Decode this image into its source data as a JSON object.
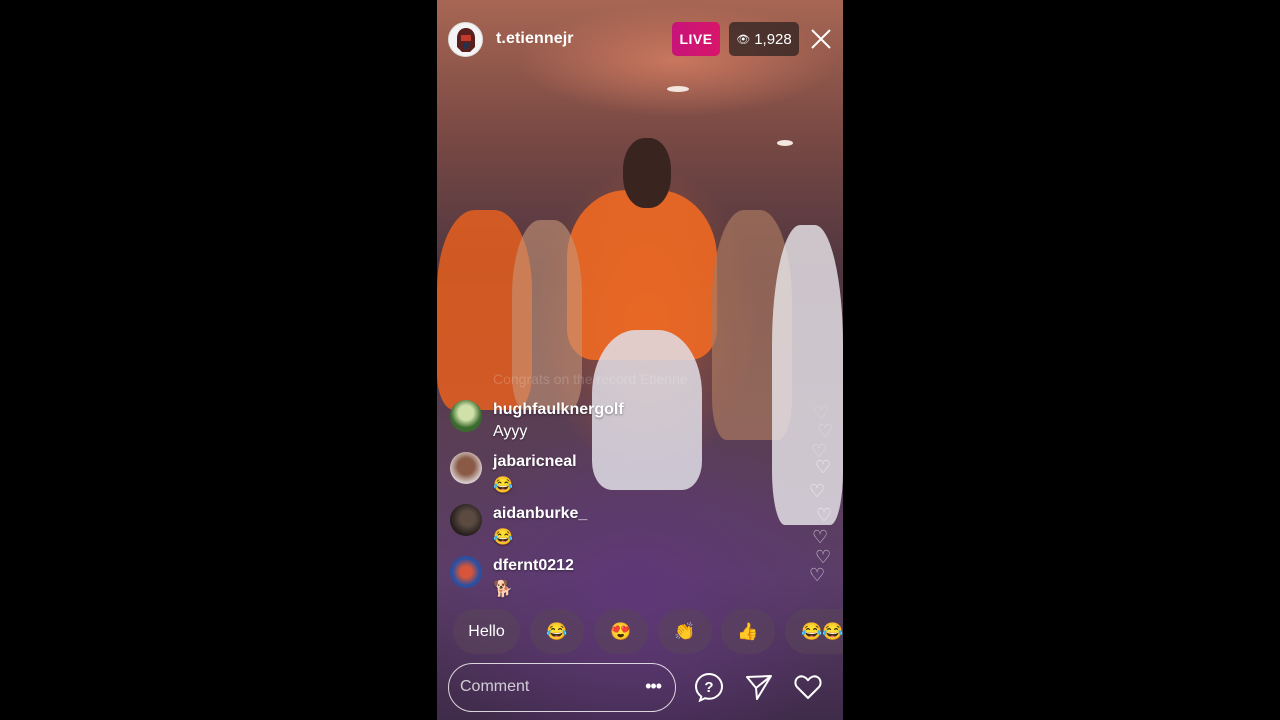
{
  "host": {
    "username": "t.etiennejr",
    "avatar_icon": "helmet-logo-icon"
  },
  "live_badge": "LIVE",
  "viewers": {
    "icon": "eye-icon",
    "count": "1,928"
  },
  "close_icon": "close-icon",
  "ghost_comment": "Congrats on the record Etienne",
  "comments": [
    {
      "user": "hughfaulknergolf",
      "text": "Ayyy"
    },
    {
      "user": "jabaricneal",
      "text": "😂"
    },
    {
      "user": "aidanburke_",
      "text": "😂"
    },
    {
      "user": "dfernt0212",
      "text": "🐕"
    }
  ],
  "quick_replies": [
    "Hello",
    "😂",
    "😍",
    "👏",
    "👍",
    "😂😂"
  ],
  "comment_bar": {
    "placeholder": "Comment",
    "more_icon": "more-horizontal-icon"
  },
  "actions": {
    "question_icon": "question-icon",
    "send_icon": "send-icon",
    "like_icon": "heart-icon"
  },
  "colors": {
    "live": "#d8166a",
    "background": "#000000"
  }
}
